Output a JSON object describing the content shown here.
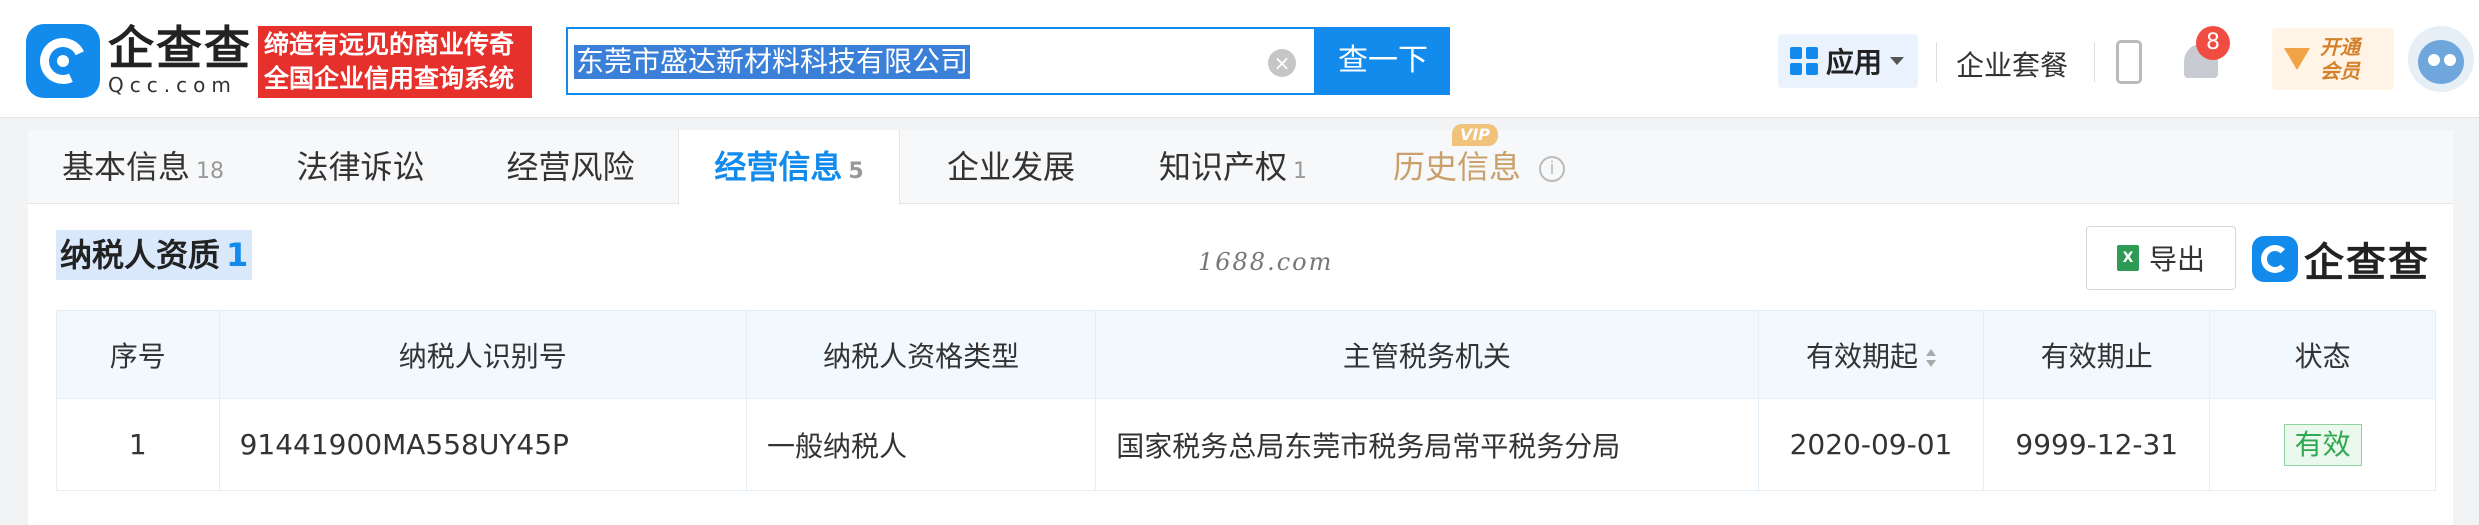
{
  "header": {
    "logo_cn": "企查查",
    "logo_en": "Qcc.com",
    "slogan_line1": "缔造有远见的商业传奇",
    "slogan_line2": "全国企业信用查询系统",
    "search_value": "东莞市盛达新材料科技有限公司",
    "search_button": "查一下",
    "apps_label": "应用",
    "suite_label": "企业套餐",
    "notification_count": "8",
    "vip_line1": "开通",
    "vip_line2": "会员"
  },
  "tabs": [
    {
      "label": "基本信息",
      "count": "18"
    },
    {
      "label": "法律诉讼",
      "count": ""
    },
    {
      "label": "经营风险",
      "count": ""
    },
    {
      "label": "经营信息",
      "count": "5",
      "active": true
    },
    {
      "label": "企业发展",
      "count": ""
    },
    {
      "label": "知识产权",
      "count": "1"
    },
    {
      "label": "历史信息",
      "count": "",
      "vip": "VIP"
    }
  ],
  "section": {
    "title": "纳税人资质",
    "count": "1",
    "watermark": "1688.com",
    "export_label": "导出",
    "brand": "企查查"
  },
  "table": {
    "headers": [
      "序号",
      "纳税人识别号",
      "纳税人资格类型",
      "主管税务机关",
      "有效期起",
      "有效期止",
      "状态"
    ],
    "rows": [
      {
        "index": "1",
        "tax_id": "91441900MA558UY45P",
        "type": "一般纳税人",
        "authority": "国家税务总局东莞市税务局常平税务分局",
        "start": "2020-09-01",
        "end": "9999-12-31",
        "status": "有效"
      }
    ]
  },
  "colors": {
    "accent": "#128bed",
    "slogan_bg": "#e6302c",
    "status_green": "#2fa84f",
    "vip_gold": "#c9a06a"
  }
}
